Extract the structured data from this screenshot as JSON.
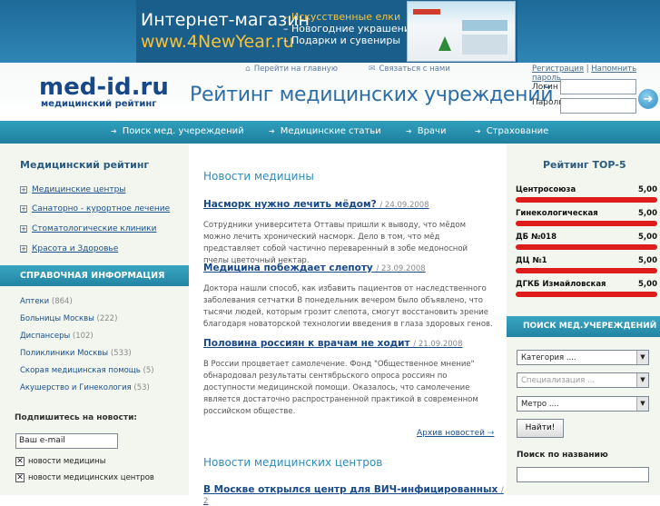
{
  "banner": {
    "shop_title": "Интернет-магазин",
    "shop_url": "www.4NewYear.ru",
    "shop_items": [
      "– Искусственные елки",
      "– Новогодние украшения",
      "– Подарки и сувениры"
    ]
  },
  "header": {
    "home_link": "Перейти на главную",
    "contact_link": "Связаться с нами",
    "logo_main": "med-id.ru",
    "logo_sub": "медицинский рейтинг",
    "site_title": "Рейтинг медицинских учреждений",
    "register_link": "Регистрация",
    "remind_link": "Напомнить пароль",
    "login_label": "Логин",
    "password_label": "Пароль"
  },
  "nav": [
    "Поиск мед. учереждений",
    "Медицинские статьи",
    "Врачи",
    "Страхование"
  ],
  "left": {
    "rating_title": "Медицинский рейтинг",
    "rating_items": [
      "Медицинские центры",
      "Санаторно - курортное лечение",
      "Стоматологические клиники",
      "Красота и Здоровье"
    ],
    "ref_title": "СПРАВОЧНАЯ ИНФОРМАЦИЯ",
    "ref_items": [
      {
        "label": "Аптеки",
        "count": "(864)"
      },
      {
        "label": "Больницы Москвы",
        "count": "(222)"
      },
      {
        "label": "Диспансеры",
        "count": "(102)"
      },
      {
        "label": "Поликлиники Москвы",
        "count": "(533)"
      },
      {
        "label": "Скорая медицинская помощь",
        "count": "(5)"
      },
      {
        "label": "Акушерство и Гинекология",
        "count": "(53)"
      }
    ],
    "subscribe_title": "Подпишитесь на новости:",
    "email_value": "Ваш e-mail",
    "checks": [
      "новости медицины",
      "новости медицинских центров"
    ]
  },
  "center": {
    "news_title": "Новости медицины",
    "news": [
      {
        "title": "Насморк нужно лечить мёдом?",
        "date": "/ 24.09.2008",
        "text": "Сотрудники университета Оттавы пришли к выводу, что мёдом можно лечить хронический насморк. Дело в том, что мёд представляет собой частично переваренный в зобе медоносной пчелы цветочный нектар."
      },
      {
        "title": "Медицина побеждает слепоту",
        "date": "/ 23.09.2008",
        "text": "Доктора нашли способ, как избавить пациентов от наследственного заболевания сетчатки В понедельник вечером было объявлено, что тысячи людей, которым грозит слепота, смогут восстановить зрение благодаря новаторской технологии введения в глаза здоровых генов."
      },
      {
        "title": "Половина россиян к врачам не ходит",
        "date": "/ 21.09.2008",
        "text": "В России процветает самолечение. Фонд \"Общественное мнение\" обнародовал результаты сентябрьского опроса россиян по доступности медицинской помощи. Оказалось, что самолечение является достаточно распространенной практикой в современном российском обществе."
      }
    ],
    "archive_link": "Архив новостей",
    "centers_title": "Новости медицинских центров",
    "centers_first": "В Москве открылся центр для ВИЧ-инфицированных",
    "centers_first_date": "/ 2"
  },
  "right": {
    "top_title": "Рейтинг ТОР-5",
    "rating": [
      {
        "name": "Центросоюза",
        "value": "5,00"
      },
      {
        "name": "Гинекологическая",
        "value": "5,00"
      },
      {
        "name": "ДБ №018",
        "value": "5,00"
      },
      {
        "name": "ДЦ №1",
        "value": "5,00"
      },
      {
        "name": "ДГКБ Измайловская",
        "value": "5,00"
      }
    ],
    "search_title": "ПОИСК МЕД.УЧЕРЕЖДЕНИЙ",
    "category": "Категория ....",
    "specialization": "Специализация ...",
    "metro": "Метро ....",
    "find_button": "Найти!",
    "by_name": "Поиск по названию"
  }
}
